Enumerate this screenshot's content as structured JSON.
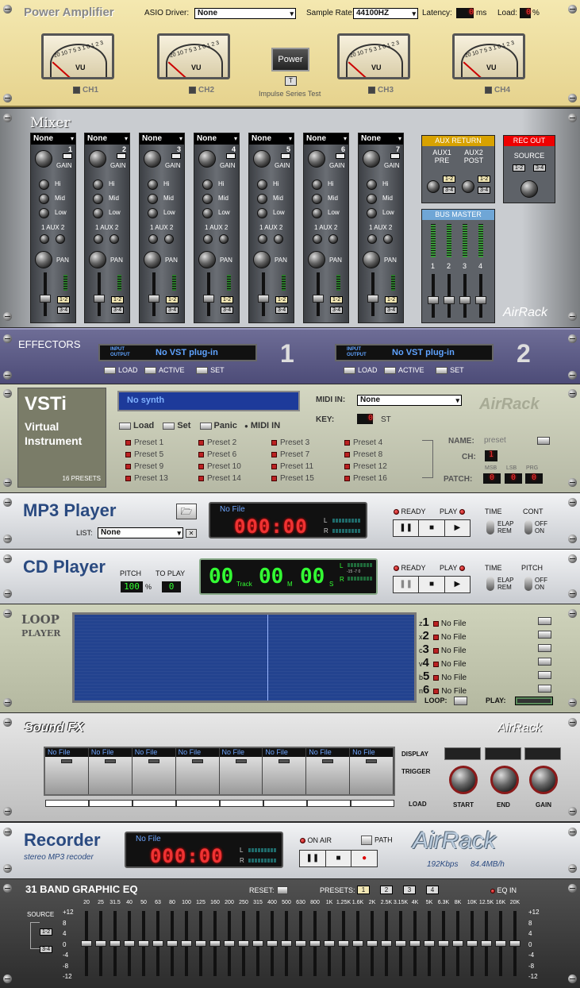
{
  "amp": {
    "title": "Power Amplifier",
    "asio_label": "ASIO Driver:",
    "asio_value": "None",
    "rate_label": "Sample Rate:",
    "rate_value": "44100HZ",
    "latency_label": "Latency:",
    "latency_unit": "ms",
    "load_label": "Load:",
    "load_unit": "%",
    "latency_value": "0",
    "load_value": "0",
    "meter_text": "VU",
    "meter_scale": "20 10 7 5 3 1 0 1 2 3",
    "channels": [
      "CH1",
      "CH2",
      "CH3",
      "CH4"
    ],
    "power": "Power",
    "test_btn": "T",
    "impulse": "Impulse Series Test"
  },
  "mixer": {
    "title": "Mixer",
    "channels": [
      {
        "name": "None",
        "num": "1"
      },
      {
        "name": "None",
        "num": "2"
      },
      {
        "name": "None",
        "num": "3"
      },
      {
        "name": "None",
        "num": "4"
      },
      {
        "name": "None",
        "num": "5"
      },
      {
        "name": "None",
        "num": "6"
      },
      {
        "name": "None",
        "num": "7"
      }
    ],
    "labels": {
      "gain": "GAIN",
      "hi": "Hi",
      "mid": "Mid",
      "low": "Low",
      "aux": "1 AUX 2",
      "pan": "PAN",
      "out1": "1-2",
      "out2": "3-4"
    },
    "aux_return": "AUX RETURN",
    "aux1": "AUX1 PRE",
    "aux2": "AUX2 POST",
    "rec_out": "REC OUT",
    "source": "SOURCE",
    "bus_master": "BUS MASTER",
    "bus_nums": [
      "1",
      "2",
      "3",
      "4"
    ],
    "brand": "AirRack"
  },
  "effectors": {
    "title": "EFFECTORS",
    "slots": [
      {
        "num": "1",
        "plugin": "No VST plug-in"
      },
      {
        "num": "2",
        "plugin": "No VST plug-in"
      }
    ],
    "io_in": "INPUT",
    "io_out": "OUTPUT",
    "load": "LOAD",
    "active": "ACTIVE",
    "set": "SET"
  },
  "vsti": {
    "title": "VSTi",
    "sub1": "Virtual",
    "sub2": "Instrument",
    "presets_count": "16 PRESETS",
    "synth": "No synth",
    "load": "Load",
    "set": "Set",
    "panic": "Panic",
    "midi_in_chk": "MIDI IN",
    "midi_label": "MIDI IN:",
    "midi_value": "None",
    "key_label": "KEY:",
    "key_value": "0",
    "key_unit": "ST",
    "brand": "AirRack",
    "presets": [
      "Preset 1",
      "Preset 2",
      "Preset 3",
      "Preset 4",
      "Preset 5",
      "Preset 6",
      "Preset 7",
      "Preset 8",
      "Preset 9",
      "Preset 10",
      "Preset 11",
      "Preset 12",
      "Preset 13",
      "Preset 14",
      "Preset 15",
      "Preset 16"
    ],
    "name_label": "NAME:",
    "name_value": "preset",
    "ch_label": "CH:",
    "ch_value": "1",
    "patch_label": "PATCH:",
    "msb": "MSB",
    "lsb": "LSB",
    "prg": "PRG",
    "patch_values": [
      "0",
      "0",
      "0"
    ]
  },
  "mp3": {
    "title": "MP3 Player",
    "list_label": "LIST:",
    "list_value": "None",
    "file": "No File",
    "time": "000:00",
    "ready": "READY",
    "play": "PLAY",
    "time_label": "TIME",
    "elap": "ELAP",
    "rem": "REM",
    "cont": "CONT",
    "off": "OFF",
    "on": "ON",
    "l": "L",
    "r": "R",
    "clear_btn": "✕"
  },
  "cd": {
    "title": "CD Player",
    "pitch_label": "PITCH",
    "pitch_value": "100",
    "pitch_unit": "%",
    "toplay_label": "TO PLAY",
    "toplay_value": "0",
    "track": "00",
    "track_label": "Track",
    "min": "00",
    "min_label": "M",
    "sec": "00",
    "sec_label": "S",
    "ready": "READY",
    "play": "PLAY",
    "time_label": "TIME",
    "elap": "ELAP",
    "rem": "REM",
    "pitch2": "PITCH",
    "off": "OFF",
    "on": "ON",
    "l": "L",
    "r": "R",
    "meter_scale": "-15 -7 0"
  },
  "loop": {
    "title": "LOOP",
    "sub": "PLAYER",
    "slots": [
      {
        "key": "z",
        "num": "1",
        "file": "No File"
      },
      {
        "key": "x",
        "num": "2",
        "file": "No File"
      },
      {
        "key": "c",
        "num": "3",
        "file": "No File"
      },
      {
        "key": "v",
        "num": "4",
        "file": "No File"
      },
      {
        "key": "b",
        "num": "5",
        "file": "No File"
      },
      {
        "key": "n",
        "num": "6",
        "file": "No File"
      }
    ],
    "loop_label": "LOOP:",
    "play_label": "PLAY:"
  },
  "sfx": {
    "logo": "Sound FX",
    "brand": "AirRack",
    "pads": [
      "No File",
      "No File",
      "No File",
      "No File",
      "No File",
      "No File",
      "No File",
      "No File"
    ],
    "display": "DISPLAY",
    "trigger": "TRIGGER",
    "load": "LOAD",
    "start": "START",
    "end": "END",
    "gain": "GAIN"
  },
  "recorder": {
    "title": "Recorder",
    "sub": "stereo MP3 recoder",
    "file": "No File",
    "time": "000:00",
    "on_air": "ON AIR",
    "path": "PATH",
    "brand": "AirRack",
    "bitrate": "192Kbps",
    "size": "84.4MB/h",
    "l": "L",
    "r": "R"
  },
  "eq": {
    "title": "31 BAND GRAPHIC EQ",
    "reset": "RESET:",
    "presets": "PRESETS:",
    "preset_nums": [
      "1",
      "2",
      "3",
      "4"
    ],
    "eq_in": "EQ IN",
    "source": "SOURCE",
    "src1": "1-2",
    "src2": "3-4",
    "bands": [
      "20",
      "25",
      "31.5",
      "40",
      "50",
      "63",
      "80",
      "100",
      "125",
      "160",
      "200",
      "250",
      "315",
      "400",
      "500",
      "630",
      "800",
      "1K",
      "1.25K",
      "1.6K",
      "2K",
      "2.5K",
      "3.15K",
      "4K",
      "5K",
      "6.3K",
      "8K",
      "10K",
      "12.5K",
      "16K",
      "20K"
    ],
    "scale": [
      "+12",
      "8",
      "4",
      "0",
      "-4",
      "-8",
      "-12"
    ],
    "band_values": [
      0,
      0,
      0,
      0,
      0,
      0,
      0,
      0,
      0,
      0,
      0,
      0,
      0,
      0,
      0,
      0,
      0,
      0,
      0,
      0,
      0,
      0,
      0,
      0,
      0,
      0,
      0,
      0,
      0,
      0,
      0
    ]
  }
}
